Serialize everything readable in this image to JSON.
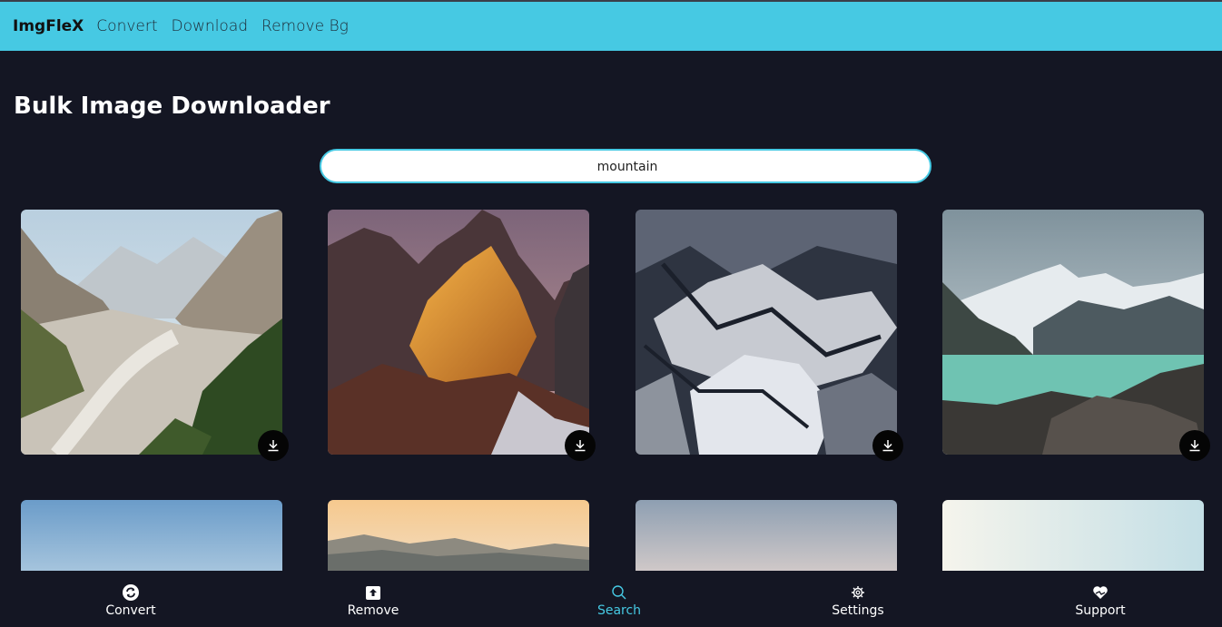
{
  "navbar": {
    "brand": "ImgFleX",
    "links": [
      "Convert",
      "Download",
      "Remove Bg"
    ]
  },
  "page": {
    "title": "Bulk Image Downloader"
  },
  "search": {
    "value": "mountain"
  },
  "bottom_nav": [
    {
      "label": "Convert",
      "icon": "convert-icon"
    },
    {
      "label": "Remove",
      "icon": "upload-box-icon"
    },
    {
      "label": "Search",
      "icon": "search-icon",
      "active": true
    },
    {
      "label": "Settings",
      "icon": "gear-icon"
    },
    {
      "label": "Support",
      "icon": "heart-hands-icon"
    }
  ],
  "colors": {
    "accent": "#46c9e3",
    "background": "#141623",
    "navbar": "#46c9e3"
  }
}
